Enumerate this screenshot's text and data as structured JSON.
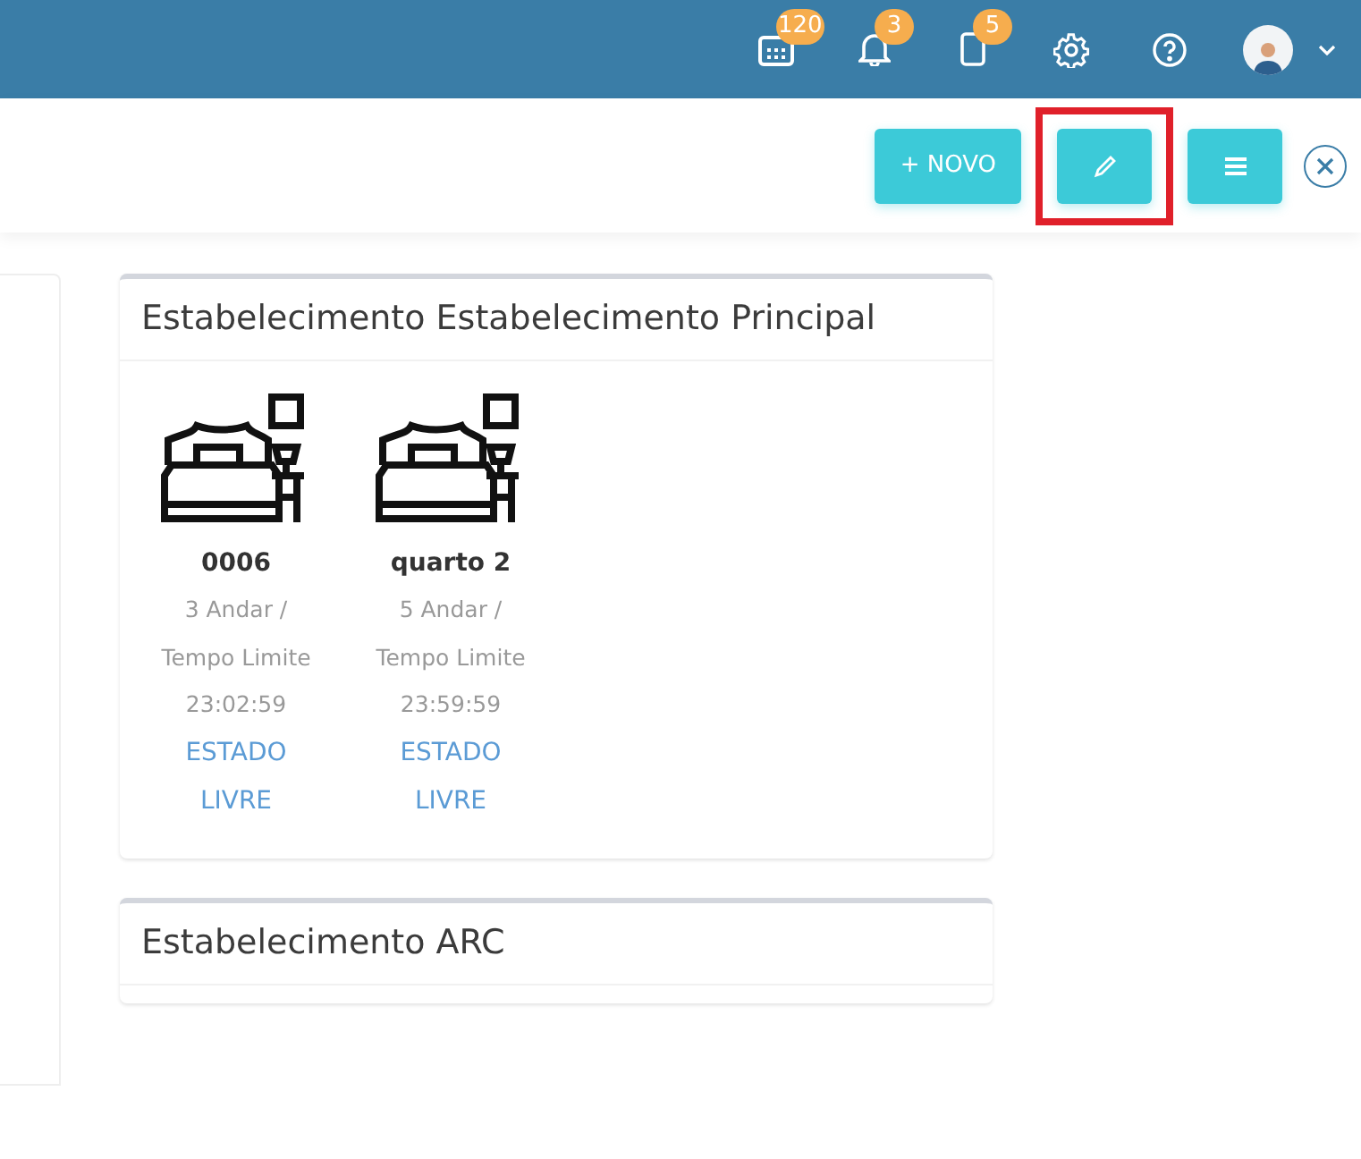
{
  "header": {
    "badges": [
      {
        "kind": "calendar",
        "count": "120"
      },
      {
        "kind": "bell",
        "count": "3"
      },
      {
        "kind": "document",
        "count": "5"
      }
    ]
  },
  "toolbar": {
    "buttons": [
      {
        "kind": "new",
        "label": "+ NOVO",
        "highlighted": false
      },
      {
        "kind": "edit",
        "highlighted": true
      },
      {
        "kind": "menu",
        "highlighted": false
      }
    ]
  },
  "establishments": [
    {
      "title": "Estabelecimento Estabelecimento Principal",
      "rooms": [
        {
          "name": "0006",
          "floor": "3 Andar /",
          "limit_label": "Tempo Limite",
          "limit_time": "23:02:59",
          "status_label": "ESTADO",
          "status": "LIVRE"
        },
        {
          "name": "quarto 2",
          "floor": "5 Andar /",
          "limit_label": "Tempo Limite",
          "limit_time": "23:59:59",
          "status_label": "ESTADO",
          "status": "LIVRE"
        }
      ]
    },
    {
      "title": "Estabelecimento ARC"
    }
  ]
}
